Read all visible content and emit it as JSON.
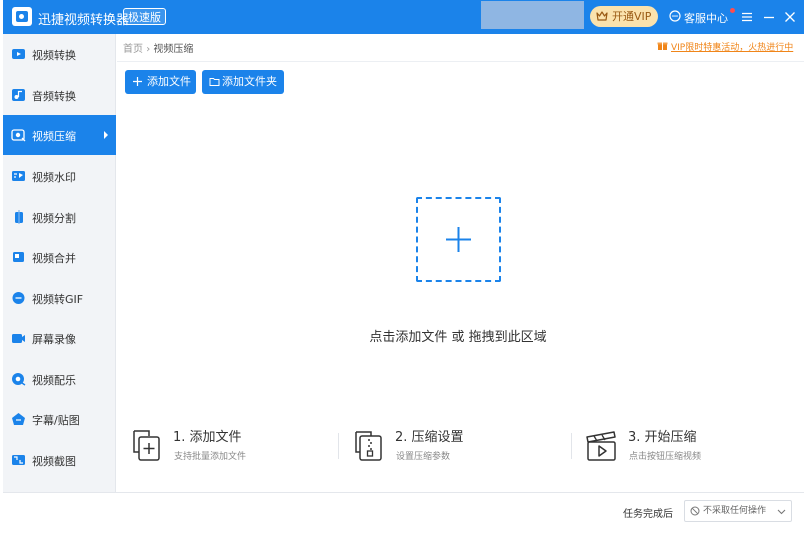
{
  "app": {
    "title": "迅捷视频转换器",
    "edition_badge": "极速版"
  },
  "titlebar": {
    "vip_label": "开通VIP",
    "service_label": "客服中心"
  },
  "sidebar": {
    "items": [
      {
        "label": "视频转换",
        "icon": "video-convert-icon"
      },
      {
        "label": "音频转换",
        "icon": "audio-convert-icon"
      },
      {
        "label": "视频压缩",
        "icon": "video-compress-icon",
        "active": true
      },
      {
        "label": "视频水印",
        "icon": "watermark-icon"
      },
      {
        "label": "视频分割",
        "icon": "split-icon"
      },
      {
        "label": "视频合并",
        "icon": "merge-icon"
      },
      {
        "label": "视频转GIF",
        "icon": "gif-icon"
      },
      {
        "label": "屏幕录像",
        "icon": "screen-record-icon"
      },
      {
        "label": "视频配乐",
        "icon": "music-icon"
      },
      {
        "label": "字幕/贴图",
        "icon": "subtitle-icon"
      },
      {
        "label": "视频截图",
        "icon": "screenshot-icon"
      }
    ]
  },
  "breadcrumb": {
    "home": "首页",
    "separator": "›",
    "current": "视频压缩"
  },
  "promo": {
    "text": "VIP限时特惠活动，火热进行中"
  },
  "toolbar": {
    "add_file": "添加文件",
    "add_folder": "添加文件夹"
  },
  "drop_zone": {
    "hint": "点击添加文件 或 拖拽到此区域"
  },
  "steps": [
    {
      "title": "1. 添加文件",
      "desc": "支持批量添加文件"
    },
    {
      "title": "2. 压缩设置",
      "desc": "设置压缩参数"
    },
    {
      "title": "3. 开始压缩",
      "desc": "点击按钮压缩视频"
    }
  ],
  "bottom": {
    "after_label": "任务完成后",
    "after_value": "不采取任何操作"
  },
  "colors": {
    "accent": "#1b83ea",
    "sidebar_bg": "#f2f4f7",
    "promo": "#f08519",
    "vip_bg": "#fbe2ad"
  }
}
